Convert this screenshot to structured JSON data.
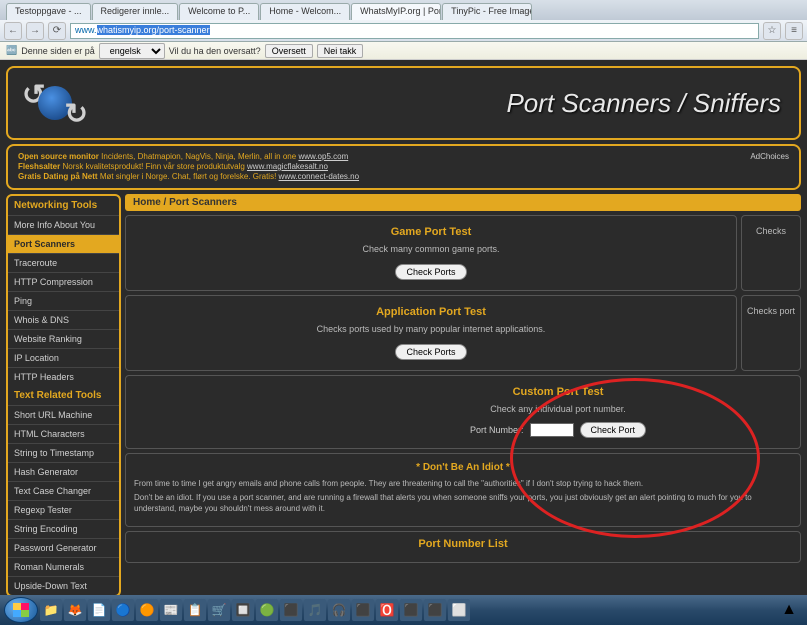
{
  "browser": {
    "tabs": [
      {
        "label": "Testoppgave - ..."
      },
      {
        "label": "Redigerer innle..."
      },
      {
        "label": "Welcome to P..."
      },
      {
        "label": "Home - Welcom..."
      },
      {
        "label": "WhatsMyIP.org | Port Scan..."
      },
      {
        "label": "TinyPic - Free Image Host..."
      }
    ],
    "url_prefix": "www.",
    "url_selected": "whatismyip.org/port-scanner",
    "translate": {
      "text": "Denne siden er på",
      "lang": "engelsk",
      "question": "Vil du ha den oversatt?",
      "btn1": "Oversett",
      "btn2": "Nei takk"
    }
  },
  "title": "Port Scanners / Sniffers",
  "ads": {
    "line1_label": "Open source monitor",
    "line1_text": "Incidents, Dhatmapion, NagVis, Ninja, Merlin, all in one",
    "line1_link": "www.op5.com",
    "line2_label": "Fleshsalter",
    "line2_text": "Norsk kvalitetsprodukt! Finn vår store produktutvalg",
    "line2_link": "www.magicflakesalt.no",
    "line3_label": "Gratis Dating på Nett",
    "line3_text": "Møt singler i Norge. Chat, flørt og forelske. Gratis!",
    "line3_link": "www.connect-dates.no",
    "adchoices": "AdChoices"
  },
  "sidebar": {
    "header1": "Networking Tools",
    "header2": "Text Related Tools",
    "items1": [
      "More Info About You",
      "Port Scanners",
      "Traceroute",
      "HTTP Compression",
      "Ping",
      "Whois & DNS",
      "Website Ranking",
      "IP Location",
      "HTTP Headers"
    ],
    "items2": [
      "Short URL Machine",
      "HTML Characters",
      "String to Timestamp",
      "Hash Generator",
      "Text Case Changer",
      "Regexp Tester",
      "String Encoding",
      "Password Generator",
      "Roman Numerals",
      "Upside-Down Text"
    ]
  },
  "breadcrumb": "Home / Port Scanners",
  "game": {
    "title": "Game Port Test",
    "desc": "Check many common game ports.",
    "btn": "Check Ports",
    "side": "Checks"
  },
  "app": {
    "title": "Application Port Test",
    "desc": "Checks ports used by many popular internet applications.",
    "btn": "Check Ports",
    "side": "Checks port"
  },
  "custom": {
    "title": "Custom Port Test",
    "desc": "Check any individual port number.",
    "label": "Port Number:",
    "btn": "Check Port"
  },
  "warning": {
    "title": "* Don't Be An Idiot *",
    "p1": "From time to time I get angry emails and phone calls from people. They are threatening to call the \"authorities\" if I don't stop trying to hack them.",
    "p2": "Don't be an idiot. If you use a port scanner, and are running a firewall that alerts you when someone sniffs your ports, you just obviously get an alert pointing to much for you to understand, maybe you shouldn't mess around with it."
  },
  "portlist": {
    "title": "Port Number List"
  },
  "taskbar_icons": [
    "📁",
    "🦊",
    "📄",
    "🔵",
    "🟠",
    "📰",
    "📋",
    "🛒",
    "🔲",
    "🟢",
    "⬛",
    "🎵",
    "🎧",
    "⬛",
    "🅾️",
    "⬛",
    "⬛",
    "⬜"
  ]
}
